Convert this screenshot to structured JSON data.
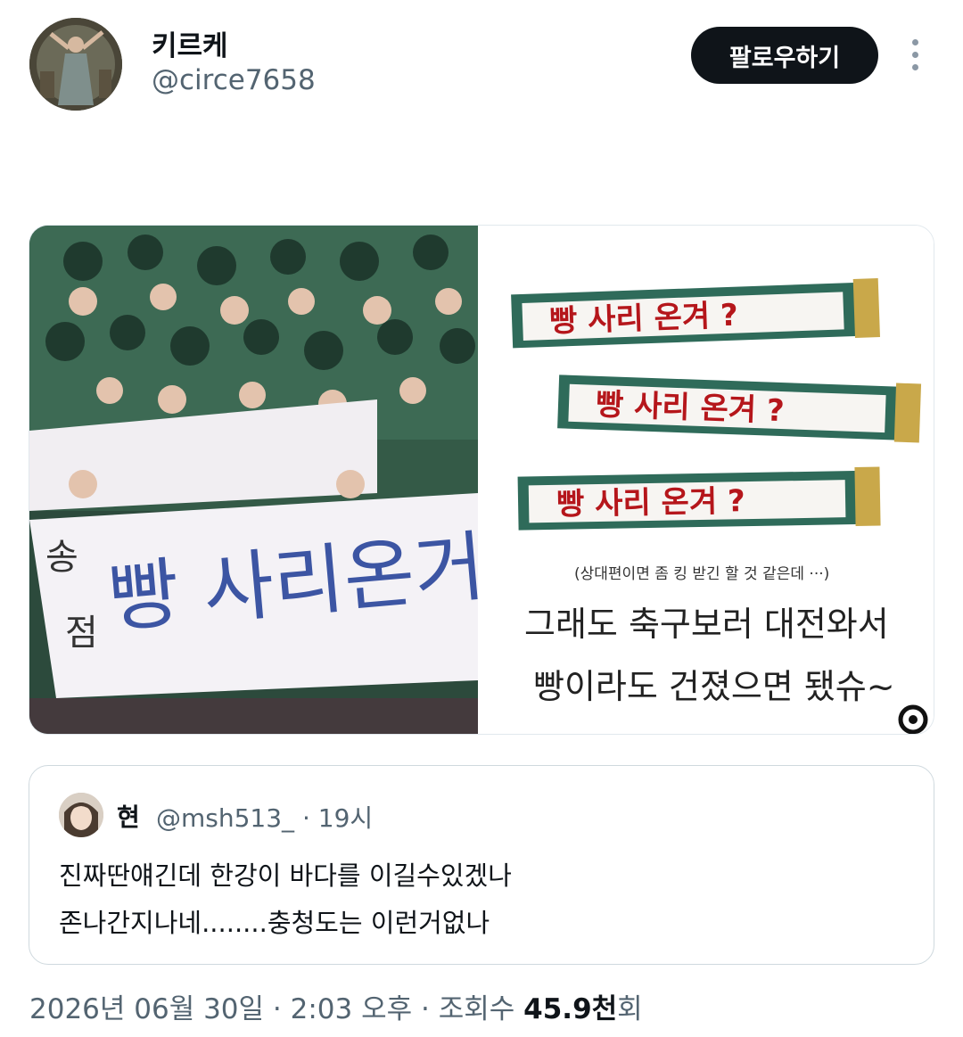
{
  "author": {
    "name": "키르케",
    "handle": "@circe7658"
  },
  "follow_button": "팔로우하기",
  "more_icon": "more-vertical-icon",
  "media": {
    "left_banner": {
      "line1": "송",
      "line2": "점",
      "text": "빵 사리온거"
    },
    "right_banners": [
      "빵 사리 온겨 ?",
      "빵 사리 온겨 ?",
      "빵 사리 온겨 ?"
    ],
    "caption_small": "(상대편이면 좀 킹 받긴 할 것 같은데 ···)",
    "caption_line1": "그래도 축구보러 대전와서",
    "caption_line2": "빵이라도 건졌으면 됐슈~"
  },
  "quote": {
    "name": "현",
    "handle": "@msh513_",
    "time": "· 19시",
    "line1": "진짜딴얘긴데 한강이 바다를 이길수있겠나",
    "line2": "존나간지나네........충청도는 이런거없나"
  },
  "footer": {
    "date": "2026년 06월 30일",
    "time": "2:03 오후",
    "views_label": "조회수",
    "views_value": "45.9천",
    "views_suffix": "회",
    "sep": "·"
  },
  "colors": {
    "text_primary": "#0f1419",
    "text_secondary": "#536471",
    "banner_green": "#2f6b5a",
    "banner_red": "#b5161b"
  }
}
